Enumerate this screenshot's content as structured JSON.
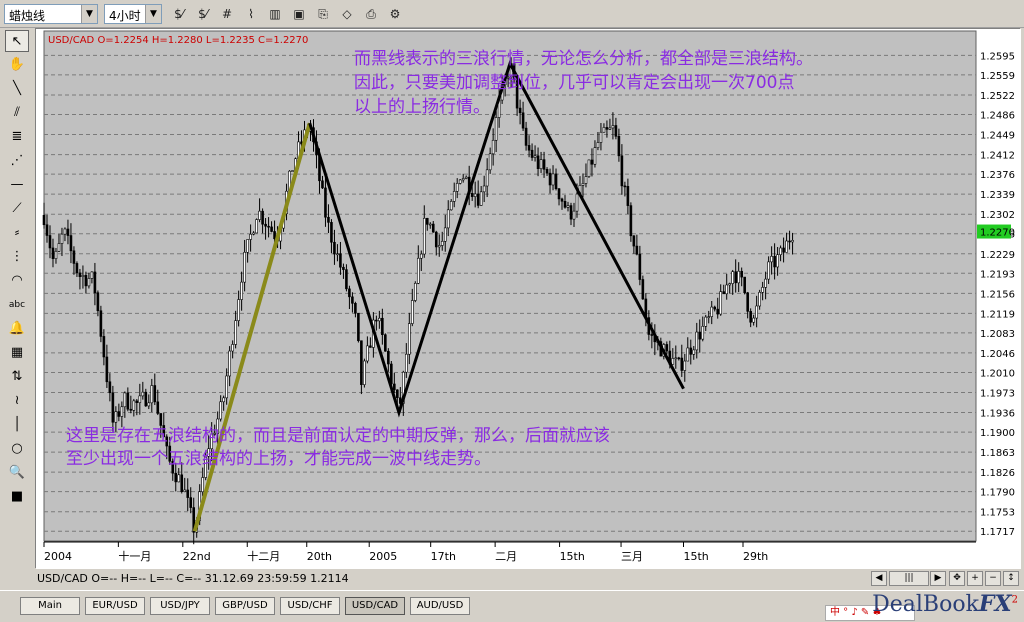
{
  "toolbar": {
    "indicator_select": "蜡烛线",
    "timeframe_select": "4小时",
    "buttons": [
      {
        "name": "dollar-slash-icon",
        "glyph": "$⁄"
      },
      {
        "name": "dollar-slash-2-icon",
        "glyph": "$⁄"
      },
      {
        "name": "grid-hash-icon",
        "glyph": "#"
      },
      {
        "name": "line-chart-icon",
        "glyph": "⌇"
      },
      {
        "name": "bar-chart-icon",
        "glyph": "▥"
      },
      {
        "name": "window-icon",
        "glyph": "▣"
      },
      {
        "name": "copy-icon",
        "glyph": "⎘"
      },
      {
        "name": "eraser-icon",
        "glyph": "◇"
      },
      {
        "name": "print-icon",
        "glyph": "⎙"
      },
      {
        "name": "properties-icon",
        "glyph": "⚙"
      }
    ]
  },
  "left_tools": [
    {
      "name": "cursor-arrow-icon",
      "glyph": "↖"
    },
    {
      "name": "hand-pan-icon",
      "glyph": "✋"
    },
    {
      "name": "trend-line-icon",
      "glyph": "╲"
    },
    {
      "name": "parallel-lines-icon",
      "glyph": "⫽"
    },
    {
      "name": "fibonacci-icon",
      "glyph": "≣"
    },
    {
      "name": "fan-lines-icon",
      "glyph": "⋰"
    },
    {
      "name": "horizontal-line-icon",
      "glyph": "—"
    },
    {
      "name": "gann-fan-icon",
      "glyph": "⟋"
    },
    {
      "name": "channel-icon",
      "glyph": "⸗"
    },
    {
      "name": "levels-icon",
      "glyph": "⋮"
    },
    {
      "name": "arc-icon",
      "glyph": "◠"
    },
    {
      "name": "text-tool-icon",
      "glyph": "abc"
    },
    {
      "name": "alarm-bell-icon",
      "glyph": "🔔"
    },
    {
      "name": "calculator-icon",
      "glyph": "▦"
    },
    {
      "name": "buy-sell-arrows-icon",
      "glyph": "⇅"
    },
    {
      "name": "zigzag-icon",
      "glyph": "≀"
    },
    {
      "name": "vertical-line-icon",
      "glyph": "│"
    },
    {
      "name": "ellipse-icon",
      "glyph": "○"
    },
    {
      "name": "zoom-icon",
      "glyph": "🔍"
    },
    {
      "name": "color-palette-icon",
      "glyph": "■"
    }
  ],
  "chart": {
    "ohlc_header": "USD/CAD O=1.2254 H=1.2280 L=1.2235 C=1.2270",
    "current_price": "1.2270",
    "annotation_top": [
      "而黑线表示的三浪行情，无论怎么分析，都全部是三浪结构。",
      "因此，只要美加调整到位，几乎可以肯定会出现一次700点",
      " 以上的上扬行情。"
    ],
    "annotation_bottom": [
      "这里是存在五浪结构的，而且是前面认定的中期反弹，那么，后面就应该",
      "至少出现一个五浪结构的上扬，才能完成一波中线走势。"
    ],
    "colors": {
      "background": "#c0c0c0",
      "candles": "#000000",
      "grid": "#7a7a7a",
      "annotation_text": "#8a2be2",
      "olive_line": "#8a8a1a",
      "black_line": "#000000",
      "header_text": "#cc0000",
      "price_label_bg": "#22cc22"
    }
  },
  "chart_data": {
    "type": "candlestick",
    "title": "USD/CAD O=1.2254 H=1.2280 L=1.2235 C=1.2270",
    "y_ticks": [
      "1.2595",
      "1.2559",
      "1.2522",
      "1.2486",
      "1.2449",
      "1.2412",
      "1.2376",
      "1.2339",
      "1.2302",
      "1.2266",
      "1.2229",
      "1.2193",
      "1.2156",
      "1.2119",
      "1.2083",
      "1.2046",
      "1.2010",
      "1.1973",
      "1.1936",
      "1.1900",
      "1.1863",
      "1.1826",
      "1.1790",
      "1.1753",
      "1.1717"
    ],
    "x_ticks": [
      "2004",
      "十一月",
      "22nd",
      "十二月",
      "20th",
      "2005",
      "17th",
      "二月",
      "15th",
      "三月",
      "15th",
      "29th"
    ],
    "ylim": [
      1.1699,
      1.264
    ],
    "price_path": [
      [
        0,
        1.23
      ],
      [
        10,
        1.221
      ],
      [
        20,
        1.227
      ],
      [
        35,
        1.219
      ],
      [
        50,
        1.218
      ],
      [
        60,
        1.205
      ],
      [
        70,
        1.191
      ],
      [
        80,
        1.196
      ],
      [
        95,
        1.195
      ],
      [
        110,
        1.198
      ],
      [
        125,
        1.185
      ],
      [
        140,
        1.18
      ],
      [
        152,
        1.1717
      ],
      [
        165,
        1.187
      ],
      [
        180,
        1.195
      ],
      [
        200,
        1.22
      ],
      [
        215,
        1.231
      ],
      [
        235,
        1.226
      ],
      [
        252,
        1.24
      ],
      [
        268,
        1.247
      ],
      [
        285,
        1.229
      ],
      [
        300,
        1.22
      ],
      [
        315,
        1.21
      ],
      [
        320,
        1.199
      ],
      [
        335,
        1.212
      ],
      [
        350,
        1.2
      ],
      [
        358,
        1.1936
      ],
      [
        370,
        1.211
      ],
      [
        385,
        1.23
      ],
      [
        400,
        1.224
      ],
      [
        420,
        1.238
      ],
      [
        440,
        1.233
      ],
      [
        460,
        1.251
      ],
      [
        470,
        1.258
      ],
      [
        485,
        1.243
      ],
      [
        500,
        1.239
      ],
      [
        515,
        1.236
      ],
      [
        530,
        1.23
      ],
      [
        545,
        1.236
      ],
      [
        560,
        1.244
      ],
      [
        575,
        1.246
      ],
      [
        590,
        1.229
      ],
      [
        600,
        1.22
      ],
      [
        610,
        1.208
      ],
      [
        625,
        1.205
      ],
      [
        640,
        1.202
      ],
      [
        660,
        1.208
      ],
      [
        680,
        1.213
      ],
      [
        695,
        1.22
      ],
      [
        705,
        1.217
      ],
      [
        715,
        1.21
      ],
      [
        730,
        1.22
      ],
      [
        745,
        1.223
      ],
      [
        755,
        1.227
      ]
    ],
    "olive_line": [
      [
        152,
        1.1717
      ],
      [
        268,
        1.247
      ]
    ],
    "black_zigzag": [
      [
        268,
        1.247
      ],
      [
        358,
        1.1936
      ],
      [
        470,
        1.258
      ],
      [
        645,
        1.198
      ]
    ]
  },
  "status": {
    "text": "USD/CAD O=-- H=-- L=-- C=--    31.12.69 23:59:59 1.2114"
  },
  "tabs": [
    "Main",
    "EUR/USD",
    "USD/JPY",
    "GBP/USD",
    "USD/CHF",
    "USD/CAD",
    "AUD/USD"
  ],
  "active_tab": "USD/CAD",
  "brand": {
    "name_part1": "DealBook",
    "name_part2": "FX",
    "sup": "2"
  },
  "tray_text": "中 ° ♪ ✎ ♣"
}
